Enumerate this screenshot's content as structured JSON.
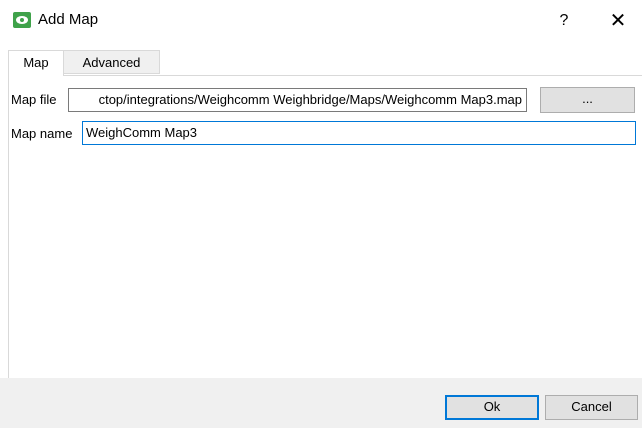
{
  "window": {
    "title": "Add Map",
    "icon": "eye-map-icon",
    "help_label": "?",
    "close_label": "✕",
    "accent_color": "#0078d7",
    "icon_color": "#3fa24a"
  },
  "tabs": [
    {
      "label": "Map",
      "active": true
    },
    {
      "label": "Advanced",
      "active": false
    }
  ],
  "form": {
    "map_file_label": "Map file",
    "map_file_value": "ctop/integrations/Weighcomm Weighbridge/Maps/Weighcomm Map3.map",
    "browse_label": "...",
    "map_name_label": "Map name",
    "map_name_value": "WeighComm Map3"
  },
  "footer": {
    "ok_label": "Ok",
    "cancel_label": "Cancel"
  }
}
